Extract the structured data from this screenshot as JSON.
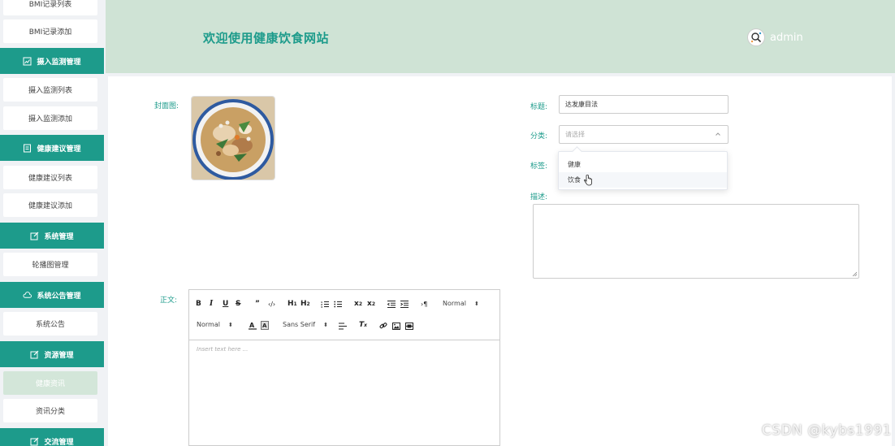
{
  "sidebar": {
    "top_partial": "BMI记录列表",
    "bmi_add": "BMI记录添加",
    "groups": [
      {
        "label": "摄入监测管理",
        "items": [
          "摄入监测列表",
          "摄入监测添加"
        ]
      },
      {
        "label": "健康建议管理",
        "items": [
          "健康建议列表",
          "健康建议添加"
        ]
      },
      {
        "label": "系统管理",
        "items": [
          "轮播图管理"
        ]
      },
      {
        "label": "系统公告管理",
        "items": [
          "系统公告"
        ]
      },
      {
        "label": "资源管理",
        "items": [
          "健康资讯",
          "资讯分类"
        ]
      },
      {
        "label": "交流管理",
        "items": []
      }
    ]
  },
  "header": {
    "welcome": "欢迎使用健康饮食网站",
    "username": "admin"
  },
  "form": {
    "cover_label": "封面图:",
    "title_label": "标题:",
    "title_value": "达发康目法",
    "category_label": "分类:",
    "category_placeholder": "请选择",
    "category_options": [
      "健康",
      "饮食"
    ],
    "tags_label": "标签:",
    "desc_label": "描述:",
    "body_label": "正文:"
  },
  "editor": {
    "header_picker": "Normal",
    "size_picker": "Normal",
    "font_picker": "Sans Serif",
    "placeholder": "Insert text here ..."
  },
  "watermark": "CSDN @kybs1991",
  "colors": {
    "accent": "#1d9b8b",
    "header_bg": "#cfe3d5",
    "active_item": "#d3e6d9"
  }
}
